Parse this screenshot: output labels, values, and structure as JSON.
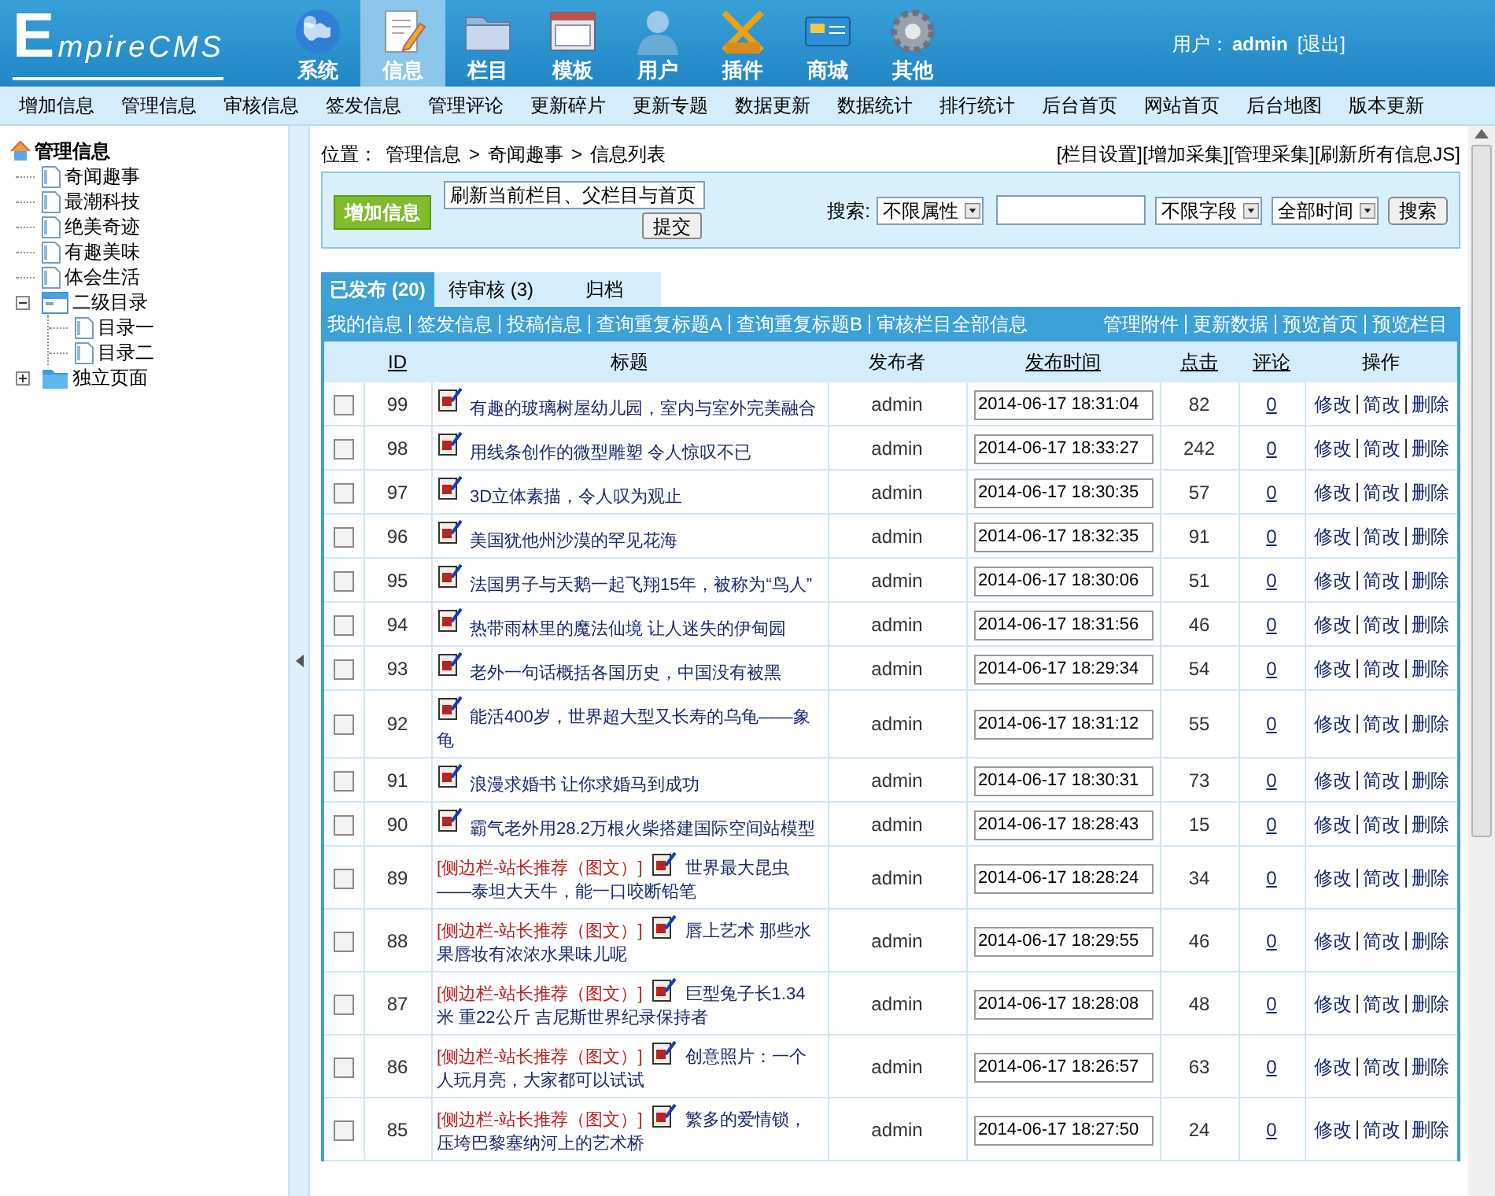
{
  "header": {
    "logo": "EmpireCMS",
    "user_label": "用户：",
    "user_name": "admin",
    "logout": "[退出]"
  },
  "nav": [
    {
      "label": "系统",
      "selected": false
    },
    {
      "label": "信息",
      "selected": true
    },
    {
      "label": "栏目",
      "selected": false
    },
    {
      "label": "模板",
      "selected": false
    },
    {
      "label": "用户",
      "selected": false
    },
    {
      "label": "插件",
      "selected": false
    },
    {
      "label": "商城",
      "selected": false
    },
    {
      "label": "其他",
      "selected": false
    }
  ],
  "menu": [
    "增加信息",
    "管理信息",
    "审核信息",
    "签发信息",
    "管理评论",
    "更新碎片",
    "更新专题",
    "数据更新",
    "数据统计",
    "排行统计",
    "后台首页",
    "网站首页",
    "后台地图",
    "版本更新"
  ],
  "tree": {
    "label": "管理信息",
    "children": [
      {
        "label": "奇闻趣事",
        "kind": "page"
      },
      {
        "label": "最潮科技",
        "kind": "page"
      },
      {
        "label": "绝美奇迹",
        "kind": "page"
      },
      {
        "label": "有趣美味",
        "kind": "page"
      },
      {
        "label": "体会生活",
        "kind": "page"
      },
      {
        "label": "二级目录",
        "kind": "group",
        "expanded": true,
        "children": [
          {
            "label": "目录一",
            "kind": "page"
          },
          {
            "label": "目录二",
            "kind": "page"
          }
        ]
      },
      {
        "label": "独立页面",
        "kind": "folder",
        "expanded": false
      }
    ]
  },
  "breadcrumb": {
    "label": "位置：",
    "separator": ">",
    "items": [
      "管理信息",
      "奇闻趣事",
      "信息列表"
    ]
  },
  "top_links": [
    "[栏目设置]",
    "[增加采集]",
    "[管理采集]",
    "[刷新所有信息JS]"
  ],
  "toolbar": {
    "add_button": "增加信息",
    "refresh_select": "刷新当前栏目、父栏目与首页",
    "submit": "提交",
    "search_label": "搜索:",
    "attribute_select": "不限属性",
    "field_select": "不限字段",
    "time_select": "全部时间",
    "search_button": "搜索"
  },
  "tabs": [
    {
      "label": "已发布 (20)",
      "selected": true
    },
    {
      "label": "待审核 (3)",
      "selected": false
    },
    {
      "label": "归档",
      "selected": false
    }
  ],
  "links_left": [
    "我的信息",
    "签发信息",
    "投稿信息",
    "查询重复标题A",
    "查询重复标题B",
    "审核栏目全部信息"
  ],
  "links_right": [
    "管理附件",
    "更新数据",
    "预览首页",
    "预览栏目"
  ],
  "columns": [
    {
      "label": "ID",
      "link": true
    },
    {
      "label": "标题",
      "link": false
    },
    {
      "label": "发布者",
      "link": false
    },
    {
      "label": "发布时间",
      "link": true
    },
    {
      "label": "点击",
      "link": true
    },
    {
      "label": "评论",
      "link": true
    },
    {
      "label": "操作",
      "link": false
    }
  ],
  "rows": [
    {
      "id": "99",
      "checked": false,
      "title": "有趣的玻璃树屋幼儿园，室内与室外完美融合",
      "publisher": "admin",
      "time": "2014-06-17 18:31:04",
      "clicks": "82",
      "comments": "0",
      "actions": [
        "修改",
        "简改",
        "删除"
      ]
    },
    {
      "id": "98",
      "checked": false,
      "title": "用线条创作的微型雕塑 令人惊叹不已",
      "publisher": "admin",
      "time": "2014-06-17 18:33:27",
      "clicks": "242",
      "comments": "0",
      "actions": [
        "修改",
        "简改",
        "删除"
      ]
    },
    {
      "id": "97",
      "checked": false,
      "title": "3D立体素描，令人叹为观止",
      "publisher": "admin",
      "time": "2014-06-17 18:30:35",
      "clicks": "57",
      "comments": "0",
      "actions": [
        "修改",
        "简改",
        "删除"
      ]
    },
    {
      "id": "96",
      "checked": false,
      "title": "美国犹他州沙漠的罕见花海",
      "publisher": "admin",
      "time": "2014-06-17 18:32:35",
      "clicks": "91",
      "comments": "0",
      "actions": [
        "修改",
        "简改",
        "删除"
      ]
    },
    {
      "id": "95",
      "checked": false,
      "title": "法国男子与天鹅一起飞翔15年，被称为“鸟人”",
      "publisher": "admin",
      "time": "2014-06-17 18:30:06",
      "clicks": "51",
      "comments": "0",
      "actions": [
        "修改",
        "简改",
        "删除"
      ]
    },
    {
      "id": "94",
      "checked": false,
      "title": "热带雨林里的魔法仙境 让人迷失的伊甸园",
      "publisher": "admin",
      "time": "2014-06-17 18:31:56",
      "clicks": "46",
      "comments": "0",
      "actions": [
        "修改",
        "简改",
        "删除"
      ]
    },
    {
      "id": "93",
      "checked": false,
      "title": "老外一句话概括各国历史，中国没有被黑",
      "publisher": "admin",
      "time": "2014-06-17 18:29:34",
      "clicks": "54",
      "comments": "0",
      "actions": [
        "修改",
        "简改",
        "删除"
      ]
    },
    {
      "id": "92",
      "checked": false,
      "title": "能活400岁，世界超大型又长寿的乌龟——象龟",
      "publisher": "admin",
      "time": "2014-06-17 18:31:12",
      "clicks": "55",
      "comments": "0",
      "actions": [
        "修改",
        "简改",
        "删除"
      ]
    },
    {
      "id": "91",
      "checked": false,
      "title": "浪漫求婚书 让你求婚马到成功",
      "publisher": "admin",
      "time": "2014-06-17 18:30:31",
      "clicks": "73",
      "comments": "0",
      "actions": [
        "修改",
        "简改",
        "删除"
      ]
    },
    {
      "id": "90",
      "checked": false,
      "title": "霸气老外用28.2万根火柴搭建国际空间站模型",
      "publisher": "admin",
      "time": "2014-06-17 18:28:43",
      "clicks": "15",
      "comments": "0",
      "actions": [
        "修改",
        "简改",
        "删除"
      ]
    },
    {
      "id": "89",
      "checked": false,
      "tag": "[侧边栏-站长推荐（图文）]",
      "title": "世界最大昆虫——泰坦大天牛，能一口咬断铅笔",
      "publisher": "admin",
      "time": "2014-06-17 18:28:24",
      "clicks": "34",
      "comments": "0",
      "actions": [
        "修改",
        "简改",
        "删除"
      ]
    },
    {
      "id": "88",
      "checked": false,
      "tag": "[侧边栏-站长推荐（图文）]",
      "title": "唇上艺术 那些水果唇妆有浓浓水果味儿呢",
      "publisher": "admin",
      "time": "2014-06-17 18:29:55",
      "clicks": "46",
      "comments": "0",
      "actions": [
        "修改",
        "简改",
        "删除"
      ]
    },
    {
      "id": "87",
      "checked": false,
      "tag": "[侧边栏-站长推荐（图文）]",
      "title": "巨型兔子长1.34米 重22公斤 吉尼斯世界纪录保持者",
      "publisher": "admin",
      "time": "2014-06-17 18:28:08",
      "clicks": "48",
      "comments": "0",
      "actions": [
        "修改",
        "简改",
        "删除"
      ]
    },
    {
      "id": "86",
      "checked": false,
      "tag": "[侧边栏-站长推荐（图文）]",
      "title": "创意照片：一个人玩月亮，大家都可以试试",
      "publisher": "admin",
      "time": "2014-06-17 18:26:57",
      "clicks": "63",
      "comments": "0",
      "actions": [
        "修改",
        "简改",
        "删除"
      ]
    },
    {
      "id": "85",
      "checked": false,
      "tag": "[侧边栏-站长推荐（图文）]",
      "title": "繁多的爱情锁，压垮巴黎塞纳河上的艺术桥",
      "publisher": "admin",
      "time": "2014-06-17 18:27:50",
      "clicks": "24",
      "comments": "0",
      "actions": [
        "修改",
        "简改",
        "删除"
      ]
    }
  ]
}
